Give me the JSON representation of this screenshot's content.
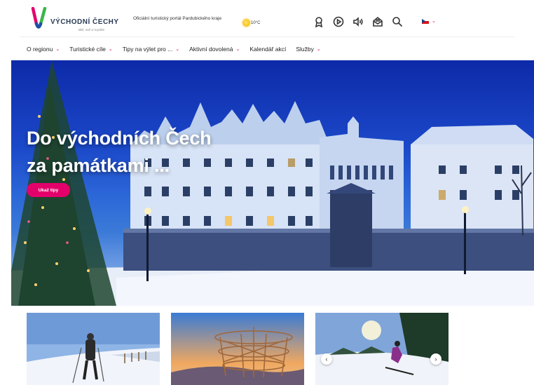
{
  "header": {
    "logo_title": "VÝCHODNÍ ČECHY",
    "logo_subtitle": "Bliž, než si myslíte",
    "tagline": "Oficiální turistický portál Pardubického kraje",
    "weather_temp": "10°C",
    "icons": [
      "badge-icon",
      "play-icon",
      "speaker-icon",
      "mail-icon",
      "search-icon"
    ],
    "language_flag": "cz-flag-icon"
  },
  "nav": {
    "items": [
      {
        "label": "O regionu",
        "has_dropdown": true
      },
      {
        "label": "Turistické cíle",
        "has_dropdown": true
      },
      {
        "label": "Tipy na výlet pro ...",
        "has_dropdown": true
      },
      {
        "label": "Aktivní dovolená",
        "has_dropdown": true
      },
      {
        "label": "Kalendář akcí",
        "has_dropdown": false
      },
      {
        "label": "Služby",
        "has_dropdown": true
      }
    ]
  },
  "hero": {
    "title_line1": "Do východních Čech",
    "title_line2": "za památkami ...",
    "button_label": "Ukaž tipy"
  },
  "colors": {
    "accent": "#e4006b",
    "text": "#222222"
  }
}
